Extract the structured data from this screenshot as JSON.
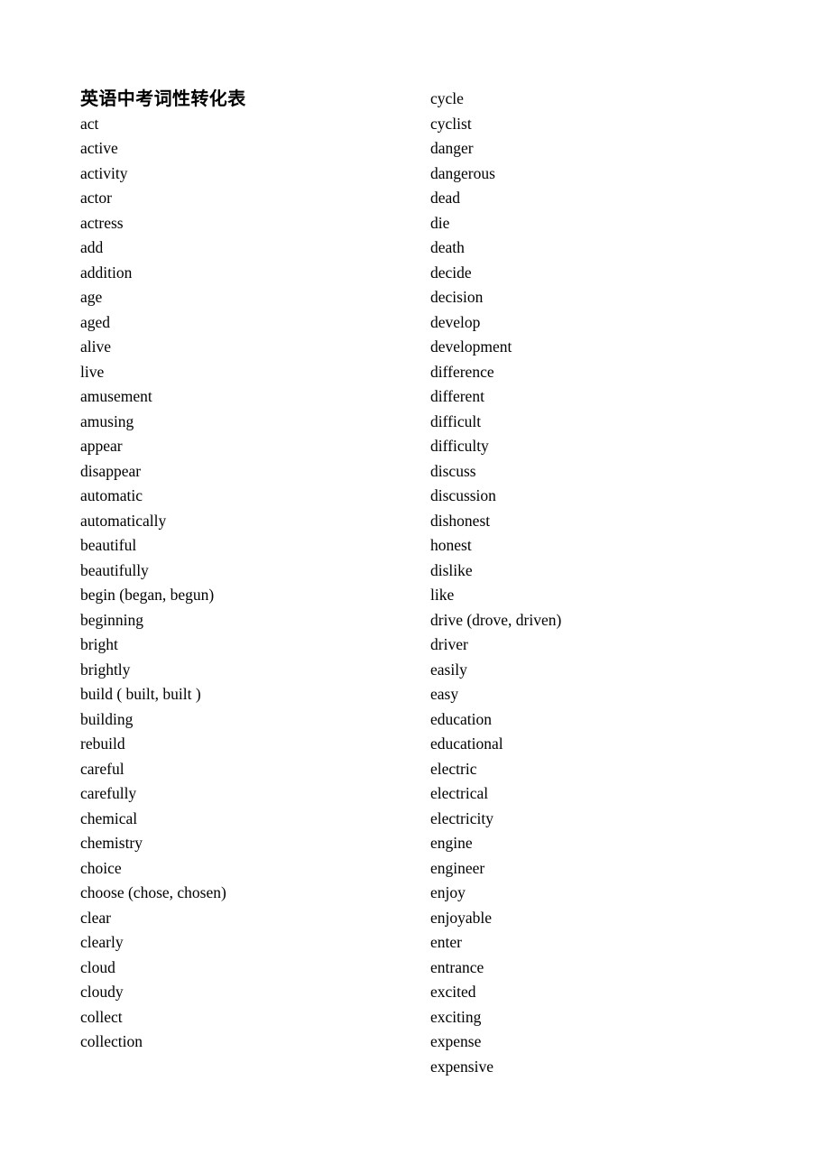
{
  "document": {
    "title": "英语中考词性转化表",
    "page_background": "#ffffff",
    "text_color": "#000000"
  },
  "columns": {
    "left": {
      "name": "left-word-column",
      "words": [
        "act",
        "active",
        "activity",
        "actor",
        "actress",
        "add",
        "addition",
        "age",
        "aged",
        "alive",
        "live",
        "amusement",
        "amusing",
        "appear",
        "disappear",
        "automatic",
        "automatically",
        "beautiful",
        "beautifully",
        "begin (began, begun)",
        "beginning",
        "bright",
        "brightly",
        "build ( built, built )",
        "building",
        "rebuild",
        "careful",
        "carefully",
        "chemical",
        "chemistry",
        "choice",
        "choose (chose, chosen)",
        "clear",
        "clearly",
        "cloud",
        "cloudy",
        "collect",
        "collection"
      ]
    },
    "right": {
      "name": "right-word-column",
      "words": [
        "cycle",
        "cyclist",
        "danger",
        "dangerous",
        "dead",
        "die",
        "death",
        "decide",
        "decision",
        "develop",
        "development",
        "difference",
        "different",
        "difficult",
        "difficulty",
        "discuss",
        "discussion",
        "dishonest",
        "honest",
        "dislike",
        "like",
        "drive (drove, driven)",
        "driver",
        "easily",
        "easy",
        "education",
        "educational",
        "electric",
        "electrical",
        "electricity",
        "engine",
        "engineer",
        "enjoy",
        "enjoyable",
        "enter",
        "entrance",
        "excited",
        "exciting",
        "expense",
        "expensive"
      ]
    }
  }
}
